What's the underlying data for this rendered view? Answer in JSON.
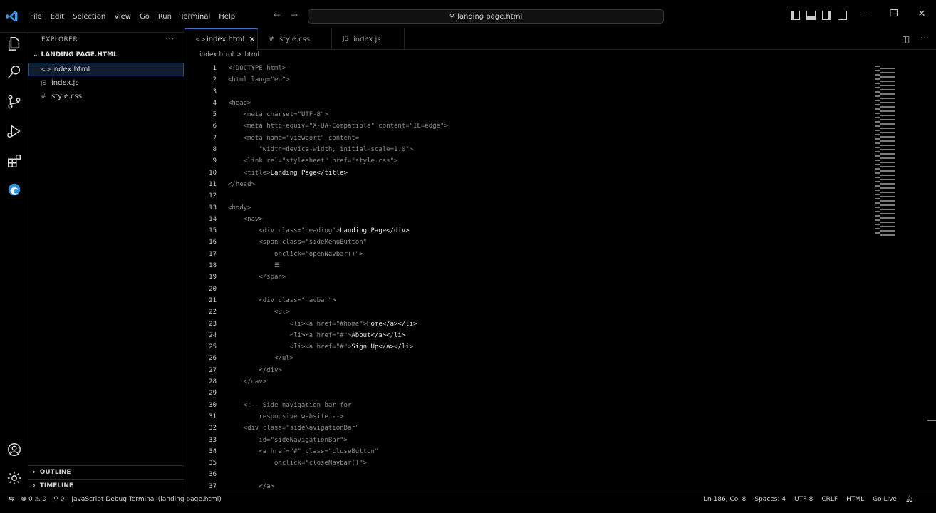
{
  "menu": [
    "File",
    "Edit",
    "Selection",
    "View",
    "Go",
    "Run",
    "Terminal",
    "Help"
  ],
  "search": {
    "text": "landing page.html"
  },
  "explorer": {
    "title": "EXPLORER",
    "more": "···",
    "folder": "LANDING PAGE.HTML",
    "files": [
      {
        "name": "index.html",
        "icon": "<>"
      },
      {
        "name": "index.js",
        "icon": "JS"
      },
      {
        "name": "style.css",
        "icon": "#"
      }
    ],
    "outline": "OUTLINE",
    "timeline": "TIMELINE"
  },
  "tabs": [
    {
      "label": "index.html",
      "icon": "<>"
    },
    {
      "label": "style.css",
      "icon": "#"
    },
    {
      "label": "index.js",
      "icon": "JS"
    }
  ],
  "breadcrumb": {
    "file": "index.html",
    "sep": ">",
    "node": "html"
  },
  "editor": {
    "lines": [
      {
        "n": "1",
        "c": "<!DOCTYPE html>",
        "t": ""
      },
      {
        "n": "2",
        "c": "<html lang=\"en\">",
        "t": ""
      },
      {
        "n": "3",
        "c": "",
        "t": ""
      },
      {
        "n": "4",
        "c": "<head>",
        "t": ""
      },
      {
        "n": "5",
        "c": "    <meta charset=\"UTF-8\">",
        "t": ""
      },
      {
        "n": "6",
        "c": "    <meta http-equiv=\"X-UA-Compatible\" content=\"IE=edge\">",
        "t": ""
      },
      {
        "n": "7",
        "c": "    <meta name=\"viewport\" content=",
        "t": ""
      },
      {
        "n": "8",
        "c": "        \"width=device-width, initial-scale=1.0\">",
        "t": ""
      },
      {
        "n": "9",
        "c": "    <link rel=\"stylesheet\" href=\"style.css\">",
        "t": ""
      },
      {
        "n": "10",
        "c": "    <title>",
        "t": "Landing Page</title>"
      },
      {
        "n": "11",
        "c": "</head>",
        "t": ""
      },
      {
        "n": "12",
        "c": "",
        "t": ""
      },
      {
        "n": "13",
        "c": "<body>",
        "t": ""
      },
      {
        "n": "14",
        "c": "    <nav>",
        "t": ""
      },
      {
        "n": "15",
        "c": "        <div class=\"heading\">",
        "t": "Landing Page</div>"
      },
      {
        "n": "16",
        "c": "        <span class=\"sideMenuButton\"",
        "t": ""
      },
      {
        "n": "17",
        "c": "            onclick=\"openNavbar()\">",
        "t": ""
      },
      {
        "n": "18",
        "c": "            ☰",
        "t": ""
      },
      {
        "n": "19",
        "c": "        </span>",
        "t": ""
      },
      {
        "n": "20",
        "c": "",
        "t": ""
      },
      {
        "n": "21",
        "c": "        <div class=\"navbar\">",
        "t": ""
      },
      {
        "n": "22",
        "c": "            <ul>",
        "t": ""
      },
      {
        "n": "23",
        "c": "                <li><a href=\"#home\">",
        "t": "Home</a></li>"
      },
      {
        "n": "24",
        "c": "                <li><a href=\"#\">",
        "t": "About</a></li>"
      },
      {
        "n": "25",
        "c": "                <li><a href=\"#\">",
        "t": "Sign Up</a></li>"
      },
      {
        "n": "26",
        "c": "            </ul>",
        "t": ""
      },
      {
        "n": "27",
        "c": "        </div>",
        "t": ""
      },
      {
        "n": "28",
        "c": "    </nav>",
        "t": ""
      },
      {
        "n": "29",
        "c": "",
        "t": ""
      },
      {
        "n": "30",
        "c": "    <!-- Side navigation bar for",
        "t": ""
      },
      {
        "n": "31",
        "c": "        responsive website -->",
        "t": ""
      },
      {
        "n": "32",
        "c": "    <div class=\"sideNavigationBar\"",
        "t": ""
      },
      {
        "n": "33",
        "c": "        id=\"sideNavigationBar\">",
        "t": ""
      },
      {
        "n": "34",
        "c": "        <a href=\"#\" class=\"closeButton\"",
        "t": ""
      },
      {
        "n": "35",
        "c": "            onclick=\"closeNavbar()\">",
        "t": ""
      },
      {
        "n": "36",
        "c": "",
        "t": ""
      },
      {
        "n": "37",
        "c": "        </a>",
        "t": ""
      }
    ]
  },
  "status": {
    "errors": "⊗ 0 ⚠ 0",
    "ports": "⚲ 0",
    "debug": "JavaScript Debug Terminal (landing page.html)",
    "position": "Ln 186, Col 8",
    "spaces": "Spaces: 4",
    "encoding": "UTF-8",
    "eol": "CRLF",
    "language": "HTML",
    "golive": "Go Live"
  }
}
